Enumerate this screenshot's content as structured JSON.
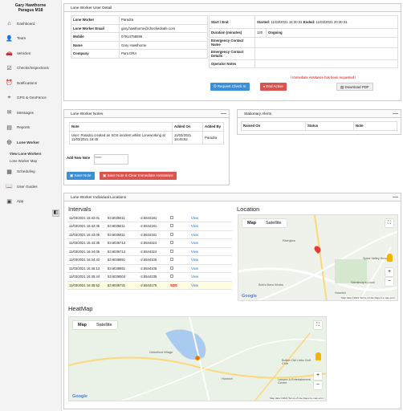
{
  "user": {
    "name": "Gary Hawthorne",
    "org": "Paragus M18"
  },
  "sidebar": {
    "items": [
      {
        "label": "Dashboard",
        "icon": "home-icon"
      },
      {
        "label": "Team",
        "icon": "team-icon"
      },
      {
        "label": "Vehicles",
        "icon": "car-icon"
      },
      {
        "label": "Checks/Inspections",
        "icon": "check-icon"
      },
      {
        "label": "Notifications",
        "icon": "bell-icon"
      },
      {
        "label": "GPS & GeoFence",
        "icon": "gps-icon"
      },
      {
        "label": "Messages",
        "icon": "message-icon"
      },
      {
        "label": "Reports",
        "icon": "report-icon"
      },
      {
        "label": "Lone Worker",
        "icon": "globe-icon"
      }
    ],
    "sub_items": [
      "View Lone Workers",
      "Lone Worker Map"
    ],
    "items2": [
      {
        "label": "Scheduling",
        "icon": "calendar-icon"
      },
      {
        "label": "User Guides",
        "icon": "book-icon"
      },
      {
        "label": "App",
        "icon": "app-icon"
      }
    ],
    "collapse": "◧"
  },
  "detail": {
    "title": "Lone Worker User Detail",
    "left_rows": [
      {
        "label": "Lone Worker",
        "value": "Paradra"
      },
      {
        "label": "Lone Worker Email",
        "value": "gary.hawthorne@checkedsafe.com"
      },
      {
        "label": "Mobile",
        "value": "07914758596"
      },
      {
        "label": "Name",
        "value": "Gary Hawthorne"
      },
      {
        "label": "Company",
        "value": "Para DRA"
      }
    ],
    "start_end_label": "Start / End",
    "started_label": "Started:",
    "started_value": "11/03/2021 16:30:31",
    "ended_label": "Ended:",
    "ended_value": "11/03/2021 20:30:31",
    "duration_label": "Duration (minutes)",
    "duration_value": "120",
    "status_value": "Ongoing",
    "ec_name_label": "Emergency Contact Name",
    "ec_details_label": "Emergency Contact Details",
    "op_notes_label": "Operator Notes",
    "warning": "! Immediate Assitance has been requested !",
    "btn_checkin": "Request Check In",
    "btn_end": "End Active",
    "btn_pdf": "Download PDF"
  },
  "notes": {
    "title": "Lone Worker Notes",
    "headers": [
      "Note",
      "Added On",
      "Added By"
    ],
    "rows": [
      {
        "note": "User: Paradra created an SOS incident whilst Loneworking at 11/03/2021 16:45",
        "added_on": "11/03/2021 16:45:52",
        "added_by": "Paradra"
      }
    ],
    "add_label": "Add New Note",
    "placeholder": "Note",
    "btn_save": "Save Note",
    "btn_save_clear": "Save Note & Clear Immediate Assistance"
  },
  "alerts": {
    "title": "Stationary Alerts",
    "headers": [
      "Raised On",
      "Status",
      "Note"
    ]
  },
  "locations": {
    "title": "Lone Worker Individual Locations",
    "intervals_title": "Intervals",
    "location_title": "Location",
    "heatmap_title": "HeatMap",
    "view_label": "View",
    "rows": [
      {
        "time": "11/03/2021 16:42:01",
        "lat": "53.6038411",
        "lng": "-2.5544181",
        "sos": ""
      },
      {
        "time": "11/03/2021 16:42:35",
        "lat": "53.6038411",
        "lng": "-2.5544181",
        "sos": ""
      },
      {
        "time": "11/03/2021 16:43:05",
        "lat": "53.6038411",
        "lng": "-2.5544181",
        "sos": ""
      },
      {
        "time": "11/03/2021 16:43:35",
        "lat": "53.6036713",
        "lng": "-2.5544324",
        "sos": ""
      },
      {
        "time": "11/03/2021 16:44:05",
        "lat": "53.6036713",
        "lng": "-2.5544324",
        "sos": ""
      },
      {
        "time": "11/03/2021 16:44:43",
        "lat": "53.6038851",
        "lng": "-2.5544105",
        "sos": ""
      },
      {
        "time": "11/03/2021 16:45:13",
        "lat": "53.6038851",
        "lng": "-2.5544105",
        "sos": ""
      },
      {
        "time": "11/03/2021 16:45:44",
        "lat": "53.6036504",
        "lng": "-2.5544235",
        "sos": ""
      },
      {
        "time": "11/03/2021 16:45:52",
        "lat": "53.6036731",
        "lng": "-2.5544176",
        "sos": "SOS"
      }
    ]
  },
  "map": {
    "tab_map": "Map",
    "tab_satellite": "Satellite",
    "google": "Google",
    "attribution": "Map data ©2021  Terms of Use  Report a map error",
    "places": [
      "Rivington",
      "Horwich",
      "Spice Valley Horwich",
      "Bob's Brew Works",
      "Sainsbury's Local",
      "Grimeford Village",
      "Bolton Old Links Golf Club",
      "Leisure & Entertainment Centre"
    ]
  },
  "colors": {
    "primary": "#3b8fd6",
    "danger": "#d9534f",
    "warning_text": "#dd0000",
    "highlight": "#fffde0"
  }
}
